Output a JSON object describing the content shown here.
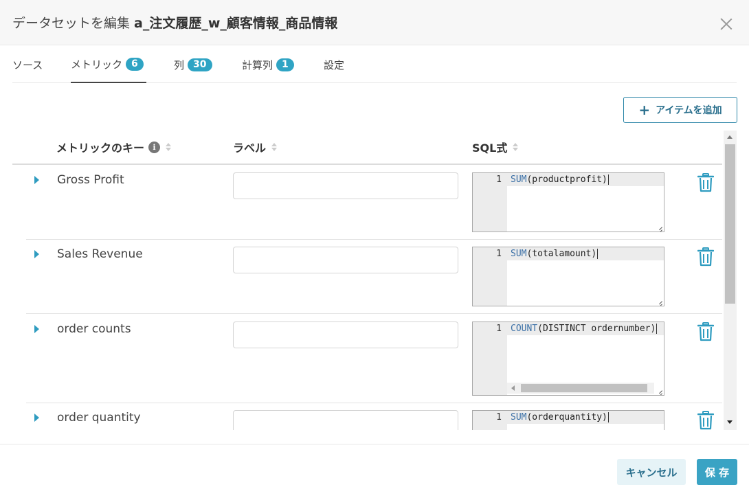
{
  "dialog": {
    "title_prefix": "データセットを編集",
    "dataset_name": "a_注文履歴_w_顧客情報_商品情報"
  },
  "tabs": [
    {
      "label": "ソース",
      "badge": null,
      "active": false
    },
    {
      "label": "メトリック",
      "badge": "6",
      "active": true
    },
    {
      "label": "列",
      "badge": "30",
      "active": false
    },
    {
      "label": "計算列",
      "badge": "1",
      "active": false
    },
    {
      "label": "設定",
      "badge": null,
      "active": false
    }
  ],
  "add_item_label": "アイテムを追加",
  "columns": {
    "metric_key": "メトリックのキー",
    "label": "ラベル",
    "sql": "SQL式"
  },
  "metrics": [
    {
      "key": "Gross Profit",
      "label": "",
      "sql_fn": "SUM",
      "sql_args": "(productprofit)",
      "line": "1"
    },
    {
      "key": "Sales Revenue",
      "label": "",
      "sql_fn": "SUM",
      "sql_args": "(totalamount)",
      "line": "1"
    },
    {
      "key": "order counts",
      "label": "",
      "sql_fn": "COUNT",
      "sql_args": "(DISTINCT ordernumber)",
      "line": "1"
    },
    {
      "key": "order quantity",
      "label": "",
      "sql_fn": "SUM",
      "sql_args": "(orderquantity)",
      "line": "1"
    }
  ],
  "footer": {
    "cancel_label": "キャンセル",
    "save_label": "保 存"
  },
  "colors": {
    "accent": "#2fa4c4",
    "primary_button": "#3aa3c4",
    "trash": "#2f9cc0"
  }
}
